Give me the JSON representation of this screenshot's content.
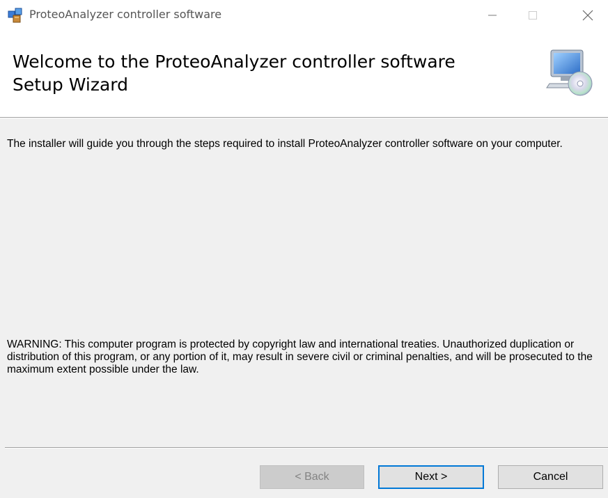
{
  "window": {
    "title": "ProteoAnalyzer controller software",
    "controls": [
      "minimize-icon",
      "maximize-icon",
      "close-icon"
    ]
  },
  "banner": {
    "title": "Welcome to the ProteoAnalyzer controller software\nSetup Wizard",
    "icon": "computer-cd-icon"
  },
  "body": {
    "intro": "The installer will guide you through the steps required to install ProteoAnalyzer controller software on your computer.",
    "warning": "WARNING: This computer program is protected by copyright law and international treaties. Unauthorized duplication or distribution of this program, or any portion of it, may result in severe civil or criminal penalties, and will be prosecuted to the maximum extent possible under the law."
  },
  "buttons": {
    "back": "< Back",
    "next": "Next >",
    "cancel": "Cancel"
  },
  "colors": {
    "body_background": "#f0f0f0",
    "accent": "#0078d7"
  }
}
